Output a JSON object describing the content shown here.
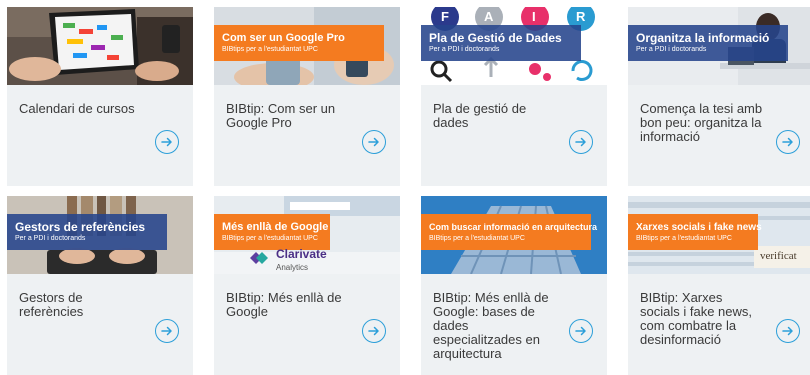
{
  "colors": {
    "accent": "#2c9fd9",
    "card_bg": "#eef1f3",
    "orange": "#f47b20",
    "navy": "#26448c"
  },
  "cards": [
    {
      "title": "Calendari de cursos",
      "banner": null
    },
    {
      "title": "BIBtip: Com ser un Google Pro",
      "banner": {
        "title": "Com ser un Google Pro",
        "subtitle": "BIBtips per a l'estudiantat UPC"
      }
    },
    {
      "title": "Pla de gestió de dades",
      "banner": {
        "title": "Pla de Gestió de Dades",
        "subtitle": "Per a PDI i doctorands",
        "letters": [
          "F",
          "A",
          "I",
          "R"
        ]
      }
    },
    {
      "title": "Comença la tesi amb bon peu: organitza la informació",
      "banner": {
        "title": "Organitza la informació",
        "subtitle": "Per a PDI i doctorands"
      }
    },
    {
      "title": "Gestors de referències",
      "banner": {
        "title": "Gestors de referències",
        "subtitle": "Per a PDI i doctorands"
      }
    },
    {
      "title": "BIBtip: Més enllà de Google",
      "banner": {
        "title": "Més enllà de Google",
        "subtitle": "BIBtips per a l'estudiantat UPC",
        "brand": "Clarivate",
        "brand_sub": "Analytics"
      }
    },
    {
      "title": "BIBtip: Més enllà de Google: bases de dades especialitzades en arquitectura",
      "banner": {
        "title": "Com buscar informació en arquitectura",
        "subtitle": "BIBtips per a l'estudiantat UPC"
      }
    },
    {
      "title": "BIBtip: Xarxes socials i fake news, com combatre la desinformació",
      "banner": {
        "title": "Xarxes socials i fake news",
        "subtitle": "BIBtips per a l'estudiantat UPC",
        "stamp": "verificat"
      }
    }
  ]
}
